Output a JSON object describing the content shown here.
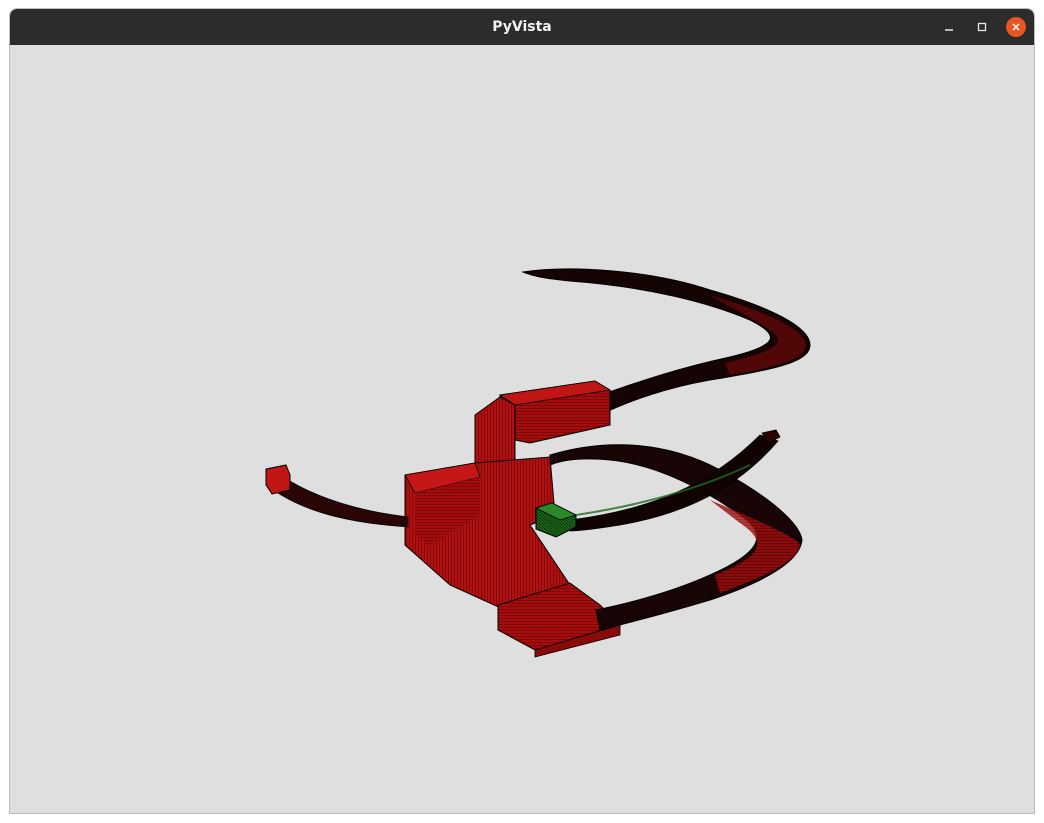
{
  "window": {
    "title": "PyVista"
  },
  "controls": {
    "minimize_icon": "minimize-icon",
    "maximize_icon": "maximize-icon",
    "close_icon": "close-icon"
  },
  "scene": {
    "background_color": "#dfdfdf",
    "mesh_color": "#b80f0f",
    "highlight_color": "#1c6b1c",
    "edge_color": "#000000"
  }
}
